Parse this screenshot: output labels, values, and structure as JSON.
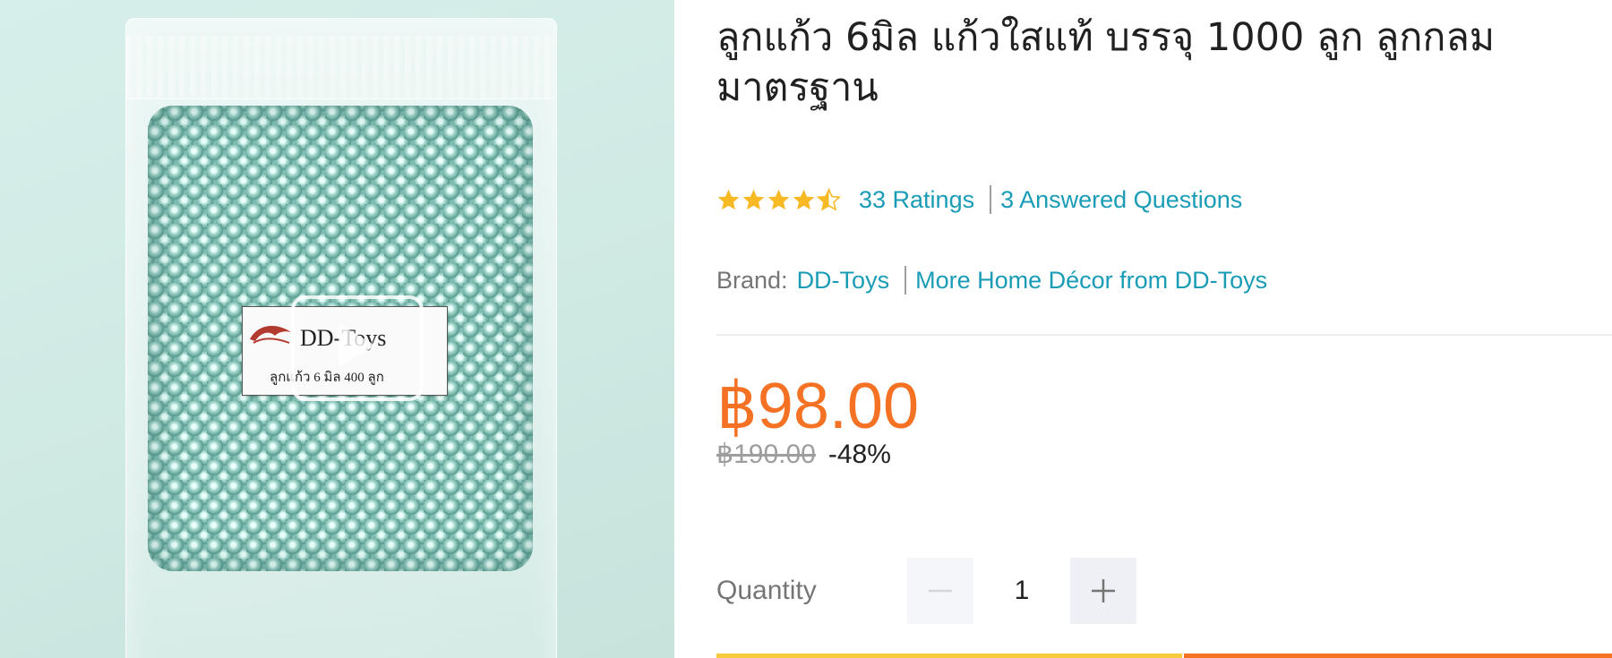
{
  "product": {
    "title": "ลูกแก้ว 6มิล แก้วใสแท้ บรรจุ 1000 ลูก ลูกกลม มาตรฐาน",
    "image": {
      "package_brand": "DD-Toys",
      "package_desc": "ลูกแก้ว 6 มิล 400 ลูก",
      "play_icon": "play-icon"
    },
    "rating": {
      "value": 4.5,
      "max": 5,
      "ratings_text": "33 Ratings",
      "questions_text": "3 Answered Questions"
    },
    "brand": {
      "label": "Brand:",
      "name": "DD-Toys",
      "more_link": "More Home Décor from DD-Toys"
    },
    "price": {
      "current": "฿98.00",
      "original": "฿190.00",
      "discount": "-48%"
    },
    "quantity": {
      "label": "Quantity",
      "value": "1",
      "minus_icon": "minus-icon",
      "plus_icon": "plus-icon"
    }
  },
  "colors": {
    "price": "#f57224",
    "link": "#1a9cb7",
    "star": "#f7b924",
    "buy_now": "#f9c93e",
    "add_to_cart": "#f57224"
  }
}
